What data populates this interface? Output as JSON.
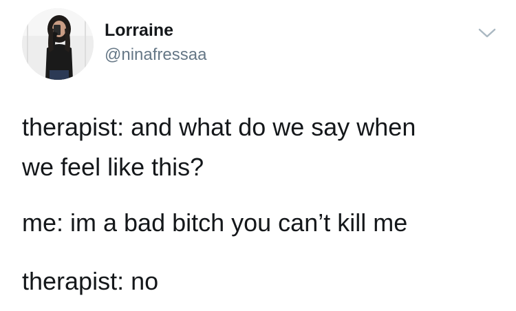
{
  "user": {
    "display_name": "Lorraine",
    "handle": "@ninafressaa",
    "avatar_icon": "profile-photo"
  },
  "menu": {
    "icon": "chevron-down-icon",
    "color": "#aab8c2"
  },
  "tweet": {
    "lines": [
      "therapist: and what do we say when",
      "we feel like this?",
      "me: im a bad bitch you can’t kill me",
      "therapist: no"
    ]
  },
  "colors": {
    "text": "#14171a",
    "secondary_text": "#657786",
    "background": "#ffffff"
  }
}
